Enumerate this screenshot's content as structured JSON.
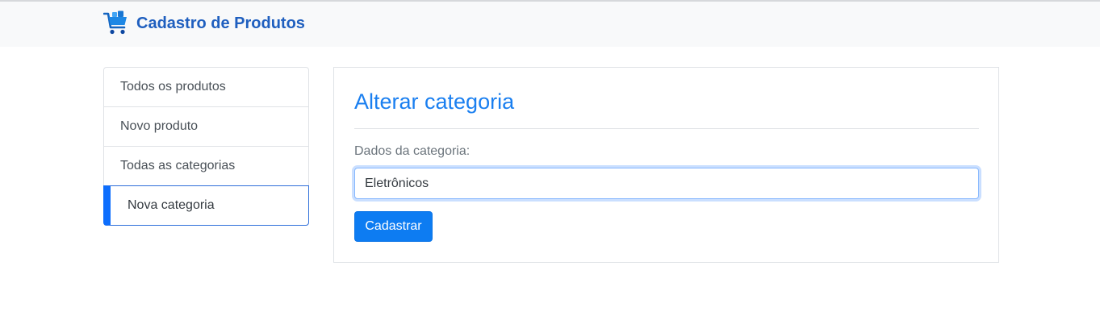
{
  "navbar": {
    "brand_title": "Cadastro de Produtos",
    "brand_icon": "shopping-cart-icon",
    "brand_color": "#1f5fbf"
  },
  "sidebar": {
    "items": [
      {
        "label": "Todos os produtos",
        "active": false
      },
      {
        "label": "Novo produto",
        "active": false
      },
      {
        "label": "Todas as categorias",
        "active": false
      },
      {
        "label": "Nova categoria",
        "active": true
      }
    ],
    "active_color": "#0d6efd"
  },
  "main": {
    "title": "Alterar categoria",
    "title_color": "#1a7ff0",
    "form": {
      "label": "Dados da categoria:",
      "input_value": "Eletrônicos",
      "submit_label": "Cadastrar",
      "submit_color": "#0d7cf2"
    }
  }
}
